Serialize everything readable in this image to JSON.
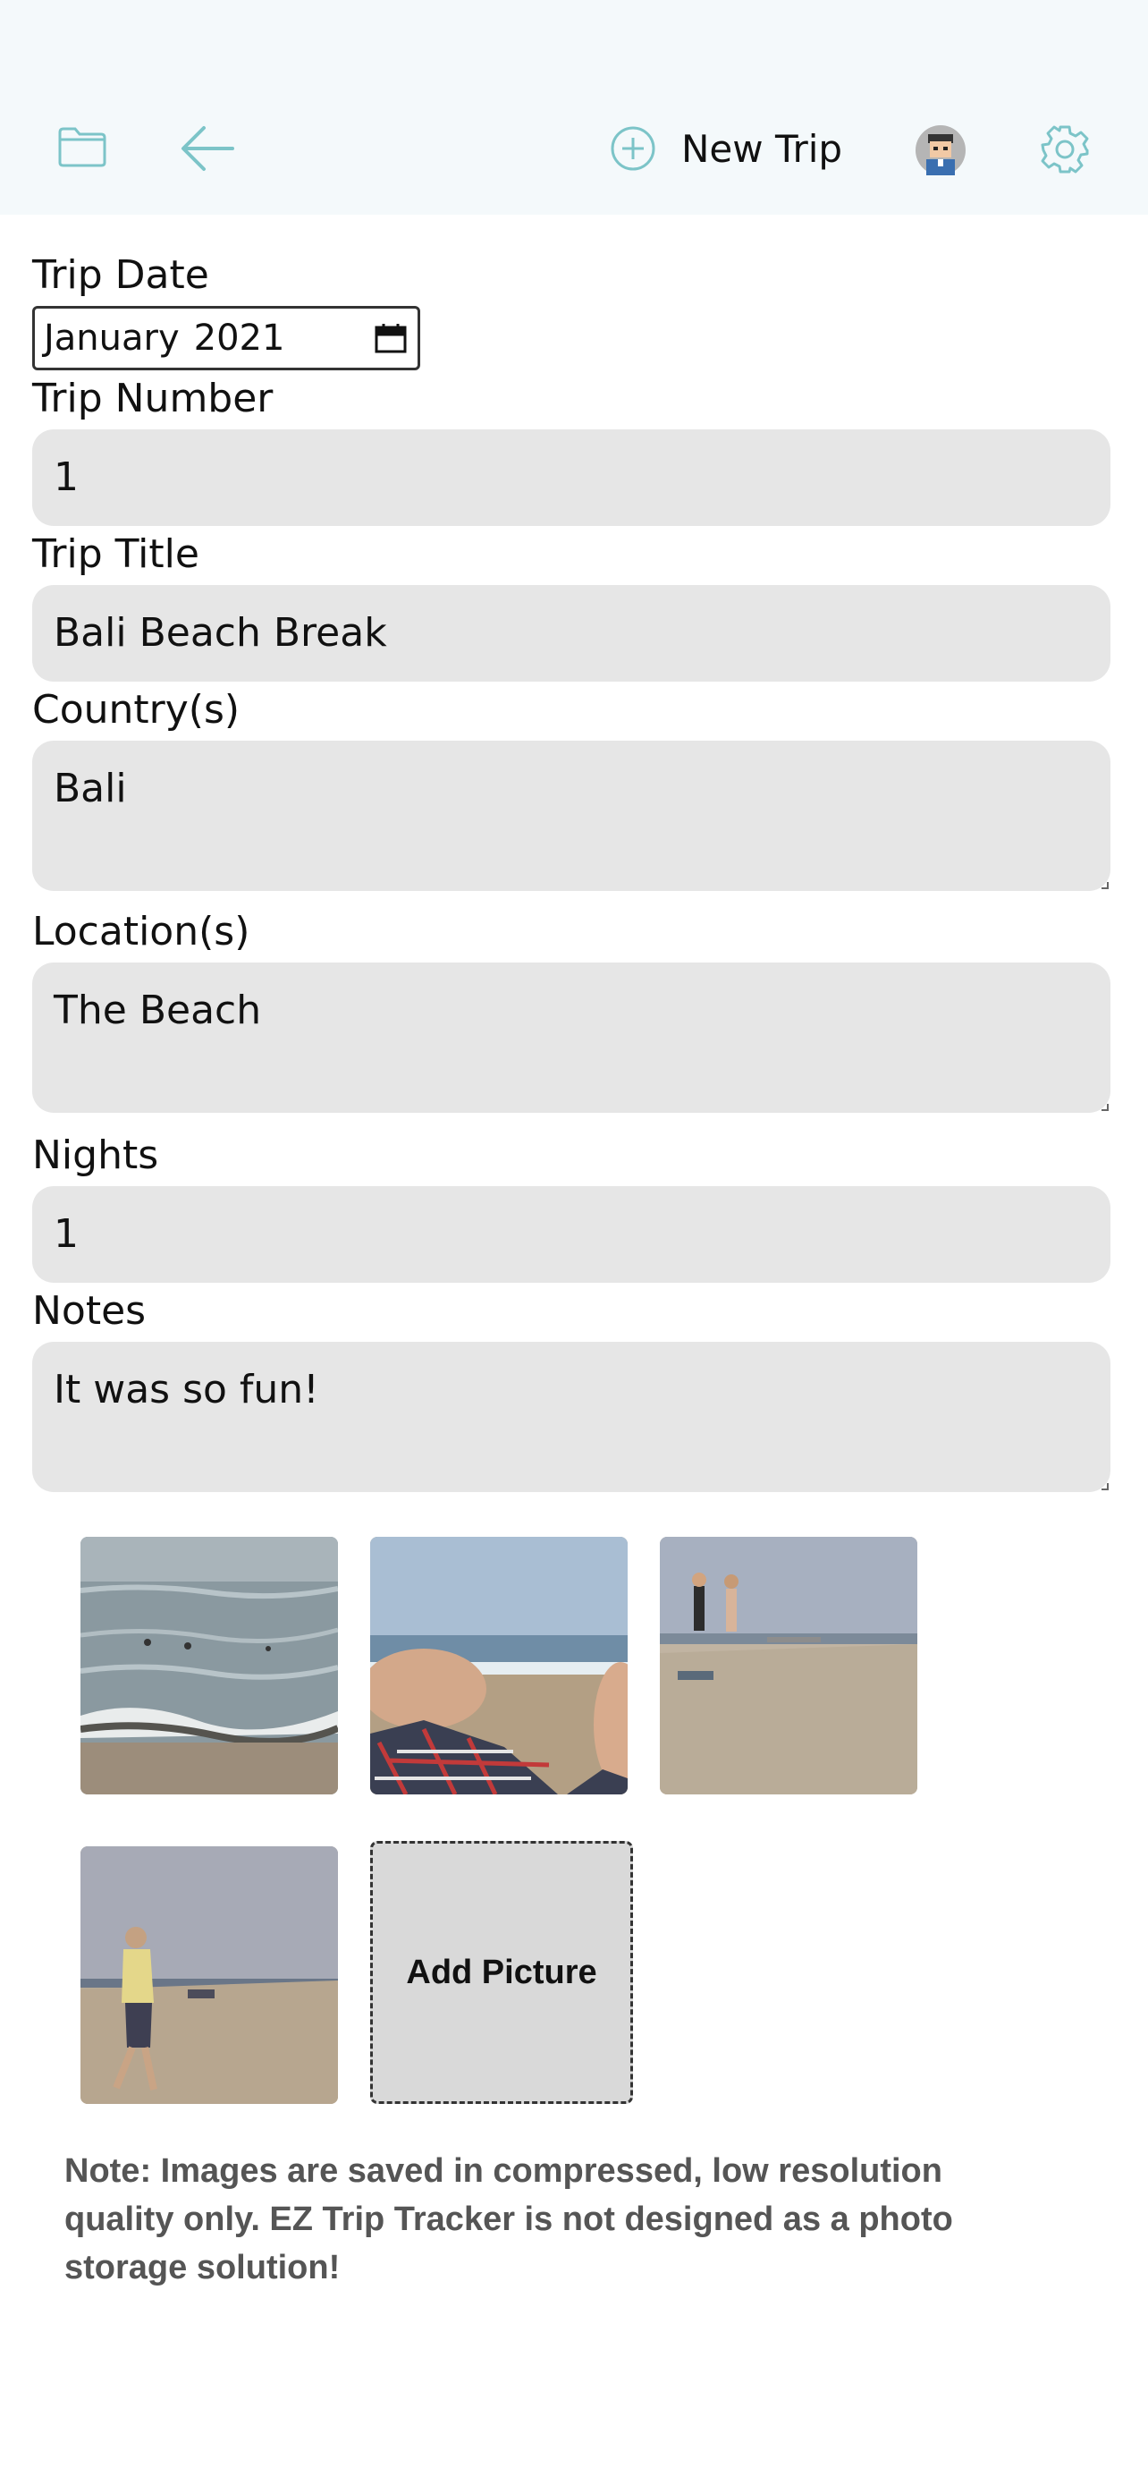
{
  "header": {
    "new_trip_label": "New Trip",
    "accent_color": "#7cc4c8",
    "icons": [
      "folder-icon",
      "back-arrow-icon",
      "plus-circle-icon",
      "avatar",
      "gear-icon"
    ]
  },
  "form": {
    "trip_date": {
      "label": "Trip Date",
      "month": "January",
      "year": "2021"
    },
    "trip_number": {
      "label": "Trip Number",
      "value": "1"
    },
    "trip_title": {
      "label": "Trip Title",
      "value": "Bali Beach Break"
    },
    "countries": {
      "label": "Country(s)",
      "value": "Bali"
    },
    "locations": {
      "label": "Location(s)",
      "value": "The Beach"
    },
    "nights": {
      "label": "Nights",
      "value": "1"
    },
    "notes": {
      "label": "Notes",
      "value": "It was so fun!"
    }
  },
  "photos": {
    "items": [
      "ocean-waves-photo",
      "beach-lying-photo",
      "beach-people-photo",
      "beach-walker-photo"
    ],
    "add_label": "Add Picture"
  },
  "footer": {
    "note": "Note: Images are saved in compressed, low resolution quality only. EZ Trip Tracker is not designed as a photo storage solution!"
  }
}
